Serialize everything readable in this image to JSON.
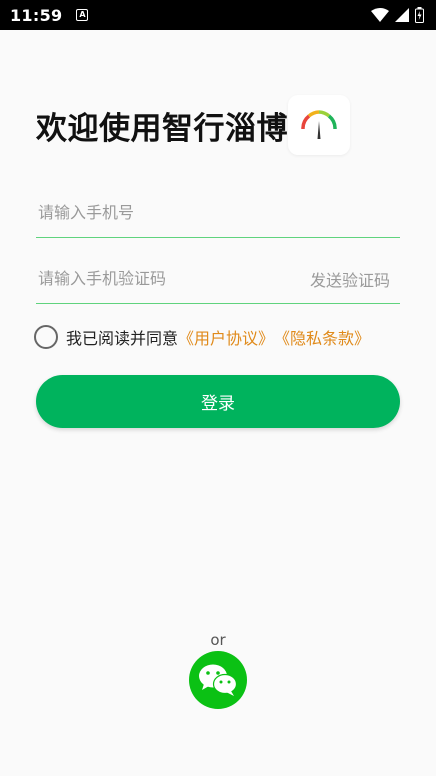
{
  "status_bar": {
    "time": "11:59",
    "notification_icon": "a-notification-icon",
    "icons": [
      "wifi-icon",
      "signal-icon",
      "battery-icon"
    ]
  },
  "welcome": {
    "title": "欢迎使用智行淄博",
    "logo_icon": "gauge-logo-icon"
  },
  "form": {
    "phone_placeholder": "请输入手机号",
    "phone_value": "",
    "code_placeholder": "请输入手机验证码",
    "code_value": "",
    "send_code_label": "发送验证码",
    "agree_text": "我已阅读并同意",
    "user_agreement_link": "《用户协议》",
    "privacy_link": "《隐私条款》",
    "agree_checked": false,
    "login_label": "登录"
  },
  "alt_login": {
    "or_label": "or",
    "wechat_icon": "wechat-icon"
  },
  "colors": {
    "accent": "#00b35d",
    "field_underline": "#5fd37d",
    "link": "#e08a1a",
    "wechat": "#0bc114"
  }
}
